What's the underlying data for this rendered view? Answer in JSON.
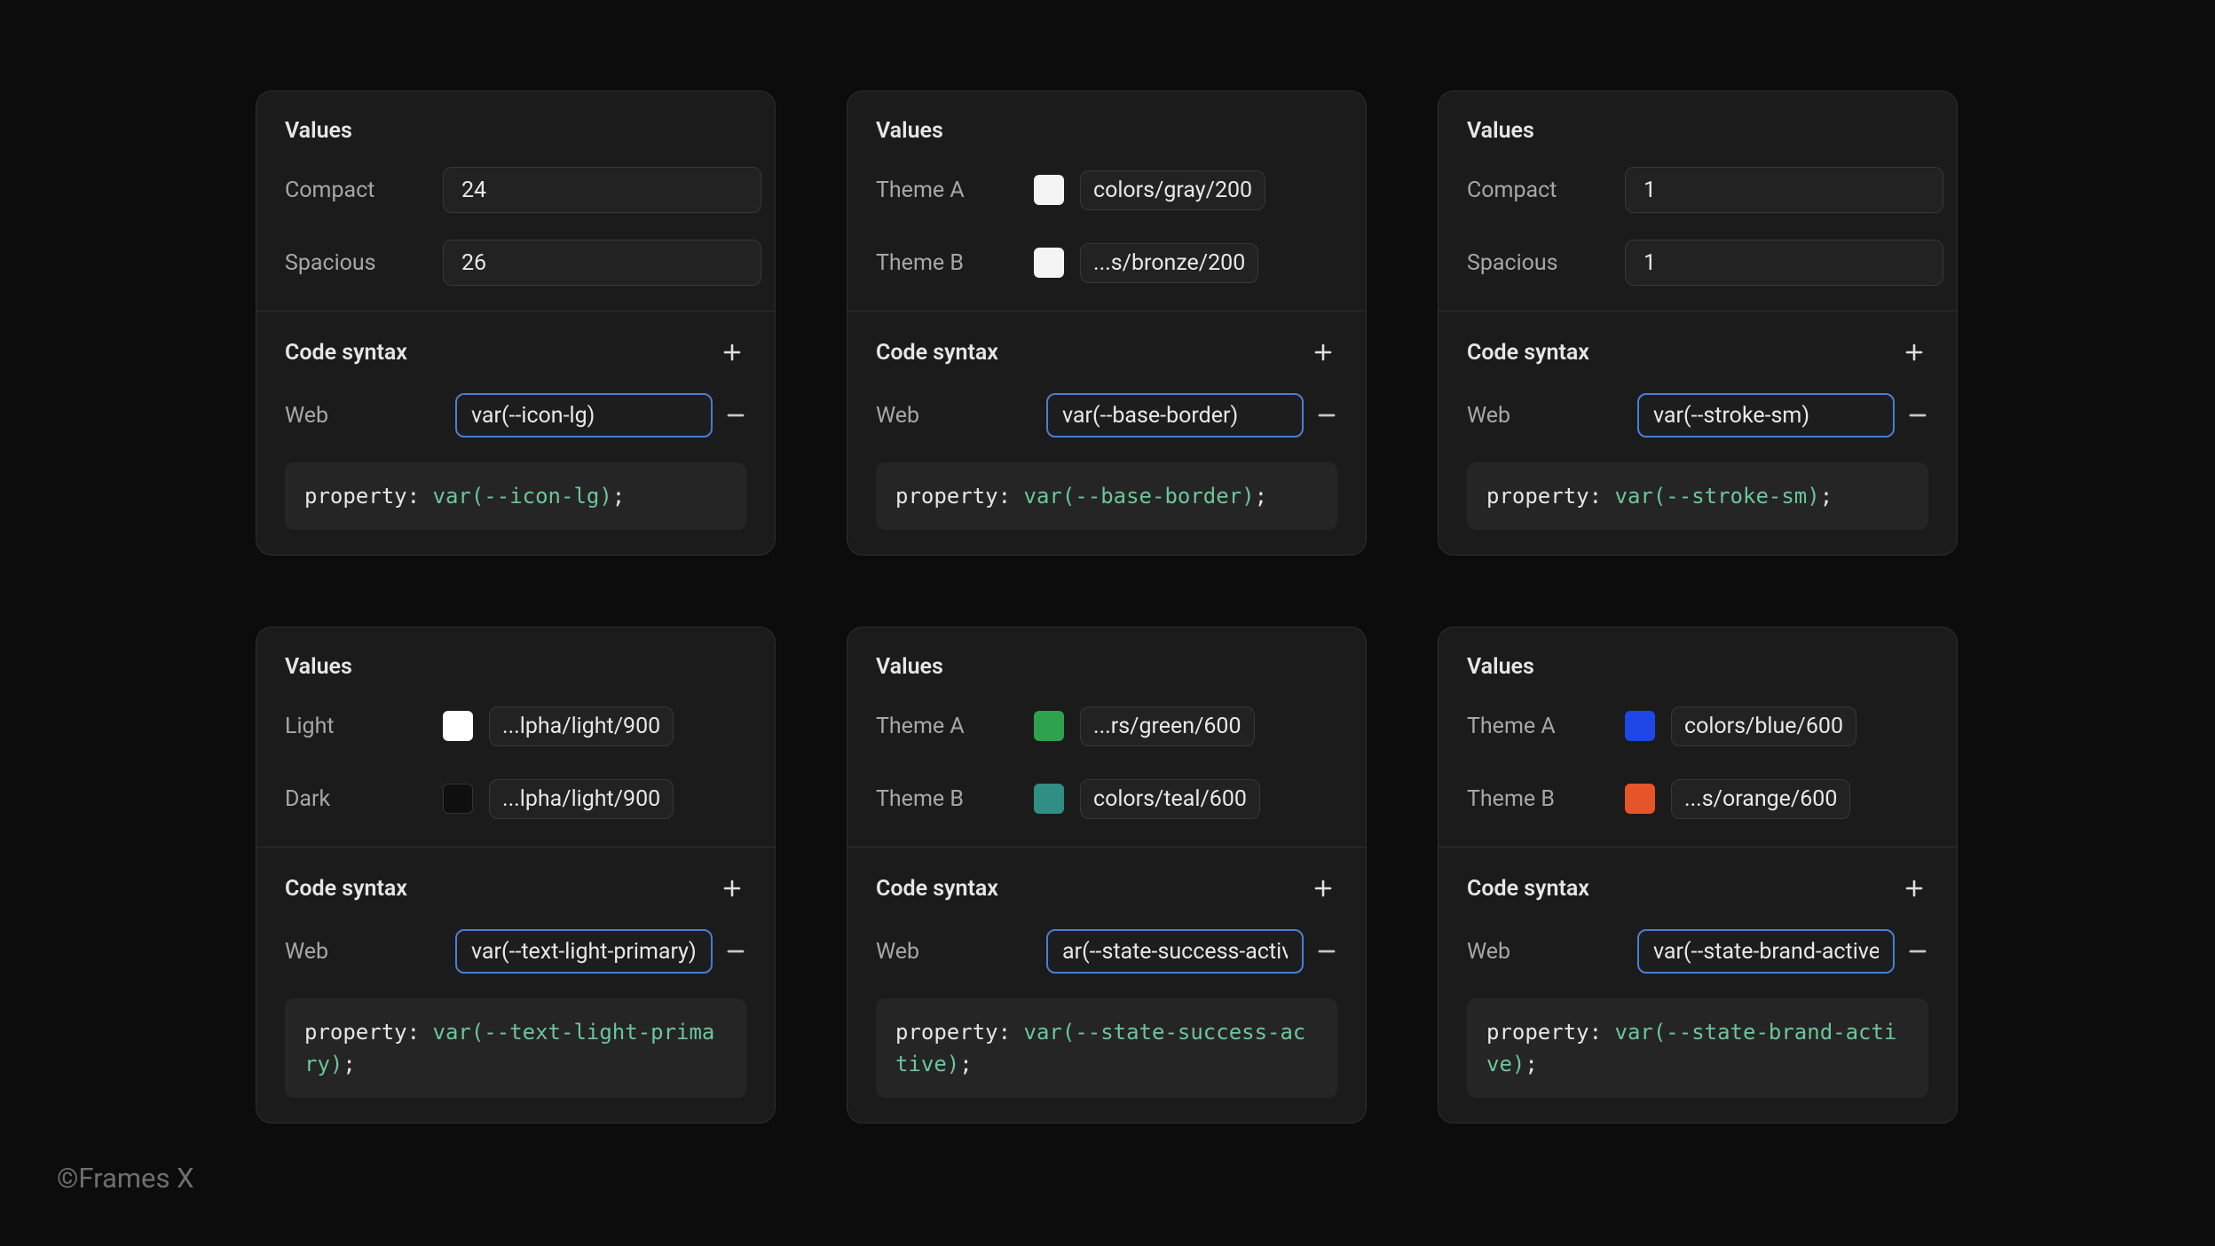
{
  "footer": "©Frames X",
  "labels": {
    "values": "Values",
    "code_syntax": "Code syntax",
    "web": "Web",
    "property_prefix": "property:",
    "semicolon": ";"
  },
  "cards": [
    {
      "rows": [
        {
          "label": "Compact",
          "kind": "num",
          "value": "24"
        },
        {
          "label": "Spacious",
          "kind": "num",
          "value": "26"
        }
      ],
      "syntax": {
        "value": "var(--icon-lg)",
        "code_val": "var(--icon-lg)"
      }
    },
    {
      "rows": [
        {
          "label": "Theme A",
          "kind": "swatch",
          "swatch": "#f4f4f4",
          "chip": "colors/gray/200"
        },
        {
          "label": "Theme B",
          "kind": "swatch",
          "swatch": "#f4f4f4",
          "chip": "...s/bronze/200"
        }
      ],
      "syntax": {
        "value": "var(--base-border)",
        "code_val": "var(--base-border)"
      }
    },
    {
      "rows": [
        {
          "label": "Compact",
          "kind": "num",
          "value": "1"
        },
        {
          "label": "Spacious",
          "kind": "num",
          "value": "1"
        }
      ],
      "syntax": {
        "value": "var(--stroke-sm)",
        "code_val": "var(--stroke-sm)"
      }
    },
    {
      "rows": [
        {
          "label": "Light",
          "kind": "swatch",
          "swatch": "#ffffff",
          "chip": "...lpha/light/900"
        },
        {
          "label": "Dark",
          "kind": "swatch",
          "swatch": "#0f0f0f",
          "chip": "...lpha/light/900"
        }
      ],
      "syntax": {
        "value": "var(--text-light-primary)",
        "code_val": "var(--text-light-primary)"
      }
    },
    {
      "rows": [
        {
          "label": "Theme A",
          "kind": "swatch",
          "swatch": "#2fa24f",
          "chip": "...rs/green/600"
        },
        {
          "label": "Theme B",
          "kind": "swatch",
          "swatch": "#2f8f84",
          "chip": "colors/teal/600"
        }
      ],
      "syntax": {
        "value": "ar(--state-success-active)",
        "code_val": "var(--state-success-active)"
      }
    },
    {
      "rows": [
        {
          "label": "Theme A",
          "kind": "swatch",
          "swatch": "#1f47e8",
          "chip": "colors/blue/600"
        },
        {
          "label": "Theme B",
          "kind": "swatch",
          "swatch": "#e6542a",
          "chip": "...s/orange/600"
        }
      ],
      "syntax": {
        "value": "var(--state-brand-active)",
        "code_val": "var(--state-brand-active)"
      }
    }
  ]
}
